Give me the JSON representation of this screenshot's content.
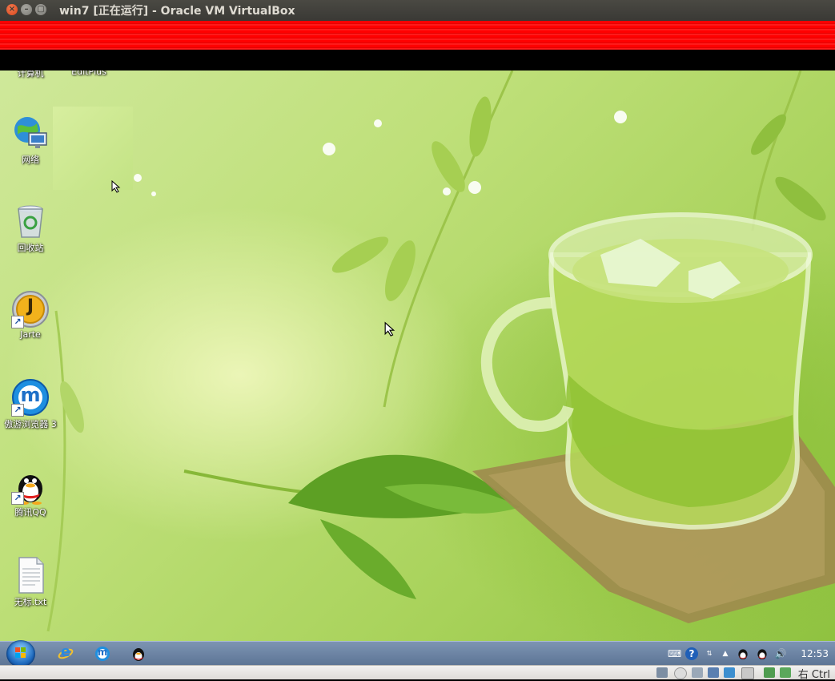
{
  "window": {
    "title": "win7 [正在运行] - Oracle VM VirtualBox",
    "close_glyph": "×",
    "minimize_glyph": "–",
    "maximize_glyph": "▢"
  },
  "desktop": {
    "icons": [
      {
        "label": "计算机",
        "icon": "computer-icon"
      },
      {
        "label": "EditPlus",
        "icon": "editplus-icon"
      },
      {
        "label": "网络",
        "icon": "network-icon"
      },
      {
        "label": "回收站",
        "icon": "recycle-bin-icon"
      },
      {
        "label": "Jarte",
        "icon": "jarte-icon",
        "glyph": "J"
      },
      {
        "label": "傲游浏览器 3",
        "icon": "maxthon-icon",
        "glyph": "m"
      },
      {
        "label": "腾讯QQ",
        "icon": "qq-icon"
      },
      {
        "label": "无标.txt",
        "icon": "text-file-icon"
      }
    ]
  },
  "taskbar": {
    "pinned": [
      {
        "icon": "internet-explorer-icon",
        "glyph": "e"
      },
      {
        "icon": "maxthon-icon",
        "glyph": "m"
      },
      {
        "icon": "qq-icon"
      }
    ],
    "tray": {
      "keyboard_glyph": "⌨",
      "help_glyph": "?",
      "arrow_glyph": "▲",
      "volume_glyph": "🔊"
    },
    "clock": "12:53"
  },
  "statusbar": {
    "host_key": "右 Ctrl"
  },
  "colors": {
    "title_bg": "#3c3b37",
    "glitch_red": "#ff0000",
    "taskbar": "#6a82a3"
  }
}
